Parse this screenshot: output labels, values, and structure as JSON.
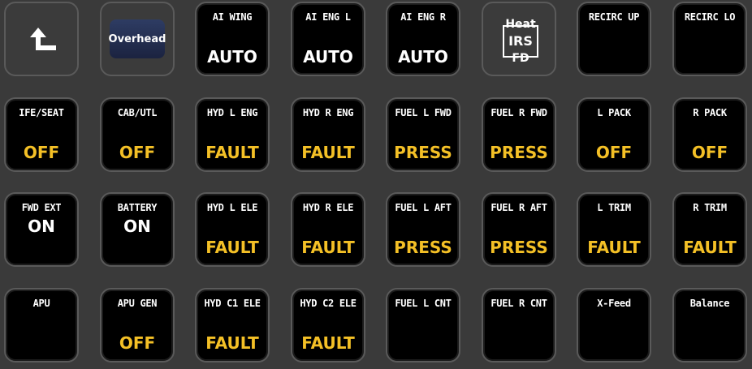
{
  "colors": {
    "white": "#ffffff",
    "amber": "#f4c026",
    "button_bg": "#000000",
    "panel_bg": "#3a3a3a"
  },
  "rows": [
    [
      {
        "name": "back",
        "icon": "back-arrow-icon"
      },
      {
        "name": "overhead",
        "label": "Overhead"
      },
      {
        "name": "ai-wing",
        "title": "AI WING",
        "state": "AUTO",
        "state_color": "white"
      },
      {
        "name": "ai-eng-l",
        "title": "AI ENG L",
        "state": "AUTO",
        "state_color": "white"
      },
      {
        "name": "ai-eng-r",
        "title": "AI ENG R",
        "state": "AUTO",
        "state_color": "white"
      },
      {
        "name": "heat-irs-fd",
        "icon": "irs-icon",
        "top": "Heat",
        "mid": "IRS",
        "bot": "FD"
      },
      {
        "name": "recirc-up",
        "title": "RECIRC UP",
        "state": ""
      },
      {
        "name": "recirc-lo",
        "title": "RECIRC LO",
        "state": ""
      }
    ],
    [
      {
        "name": "ife-seat",
        "title": "IFE/SEAT",
        "state": "OFF",
        "state_color": "amber"
      },
      {
        "name": "cab-utl",
        "title": "CAB/UTL",
        "state": "OFF",
        "state_color": "amber"
      },
      {
        "name": "hyd-l-eng",
        "title": "HYD L ENG",
        "state": "FAULT",
        "state_color": "amber"
      },
      {
        "name": "hyd-r-eng",
        "title": "HYD R ENG",
        "state": "FAULT",
        "state_color": "amber"
      },
      {
        "name": "fuel-l-fwd",
        "title": "FUEL L FWD",
        "state": "PRESS",
        "state_color": "amber"
      },
      {
        "name": "fuel-r-fwd",
        "title": "FUEL R FWD",
        "state": "PRESS",
        "state_color": "amber"
      },
      {
        "name": "l-pack",
        "title": "L PACK",
        "state": "OFF",
        "state_color": "amber"
      },
      {
        "name": "r-pack",
        "title": "R PACK",
        "state": "OFF",
        "state_color": "amber"
      }
    ],
    [
      {
        "name": "fwd-ext",
        "title": "FWD EXT",
        "state": "ON",
        "state_color": "white",
        "mid": true
      },
      {
        "name": "battery",
        "title": "BATTERY",
        "state": "ON",
        "state_color": "white",
        "mid": true
      },
      {
        "name": "hyd-l-ele",
        "title": "HYD L ELE",
        "state": "FAULT",
        "state_color": "amber"
      },
      {
        "name": "hyd-r-ele",
        "title": "HYD R ELE",
        "state": "FAULT",
        "state_color": "amber"
      },
      {
        "name": "fuel-l-aft",
        "title": "FUEL L AFT",
        "state": "PRESS",
        "state_color": "amber"
      },
      {
        "name": "fuel-r-aft",
        "title": "FUEL R AFT",
        "state": "PRESS",
        "state_color": "amber"
      },
      {
        "name": "l-trim",
        "title": "L TRIM",
        "state": "FAULT",
        "state_color": "amber"
      },
      {
        "name": "r-trim",
        "title": "R TRIM",
        "state": "FAULT",
        "state_color": "amber"
      }
    ],
    [
      {
        "name": "apu",
        "title": "APU",
        "state": ""
      },
      {
        "name": "apu-gen",
        "title": "APU GEN",
        "state": "OFF",
        "state_color": "amber"
      },
      {
        "name": "hyd-c1-ele",
        "title": "HYD C1 ELE",
        "state": "FAULT",
        "state_color": "amber"
      },
      {
        "name": "hyd-c2-ele",
        "title": "HYD C2 ELE",
        "state": "FAULT",
        "state_color": "amber"
      },
      {
        "name": "fuel-l-cnt",
        "title": "FUEL L CNT",
        "state": ""
      },
      {
        "name": "fuel-r-cnt",
        "title": "FUEL R CNT",
        "state": ""
      },
      {
        "name": "x-feed",
        "title": "X-Feed",
        "state": ""
      },
      {
        "name": "balance",
        "title": "Balance",
        "state": ""
      }
    ]
  ]
}
